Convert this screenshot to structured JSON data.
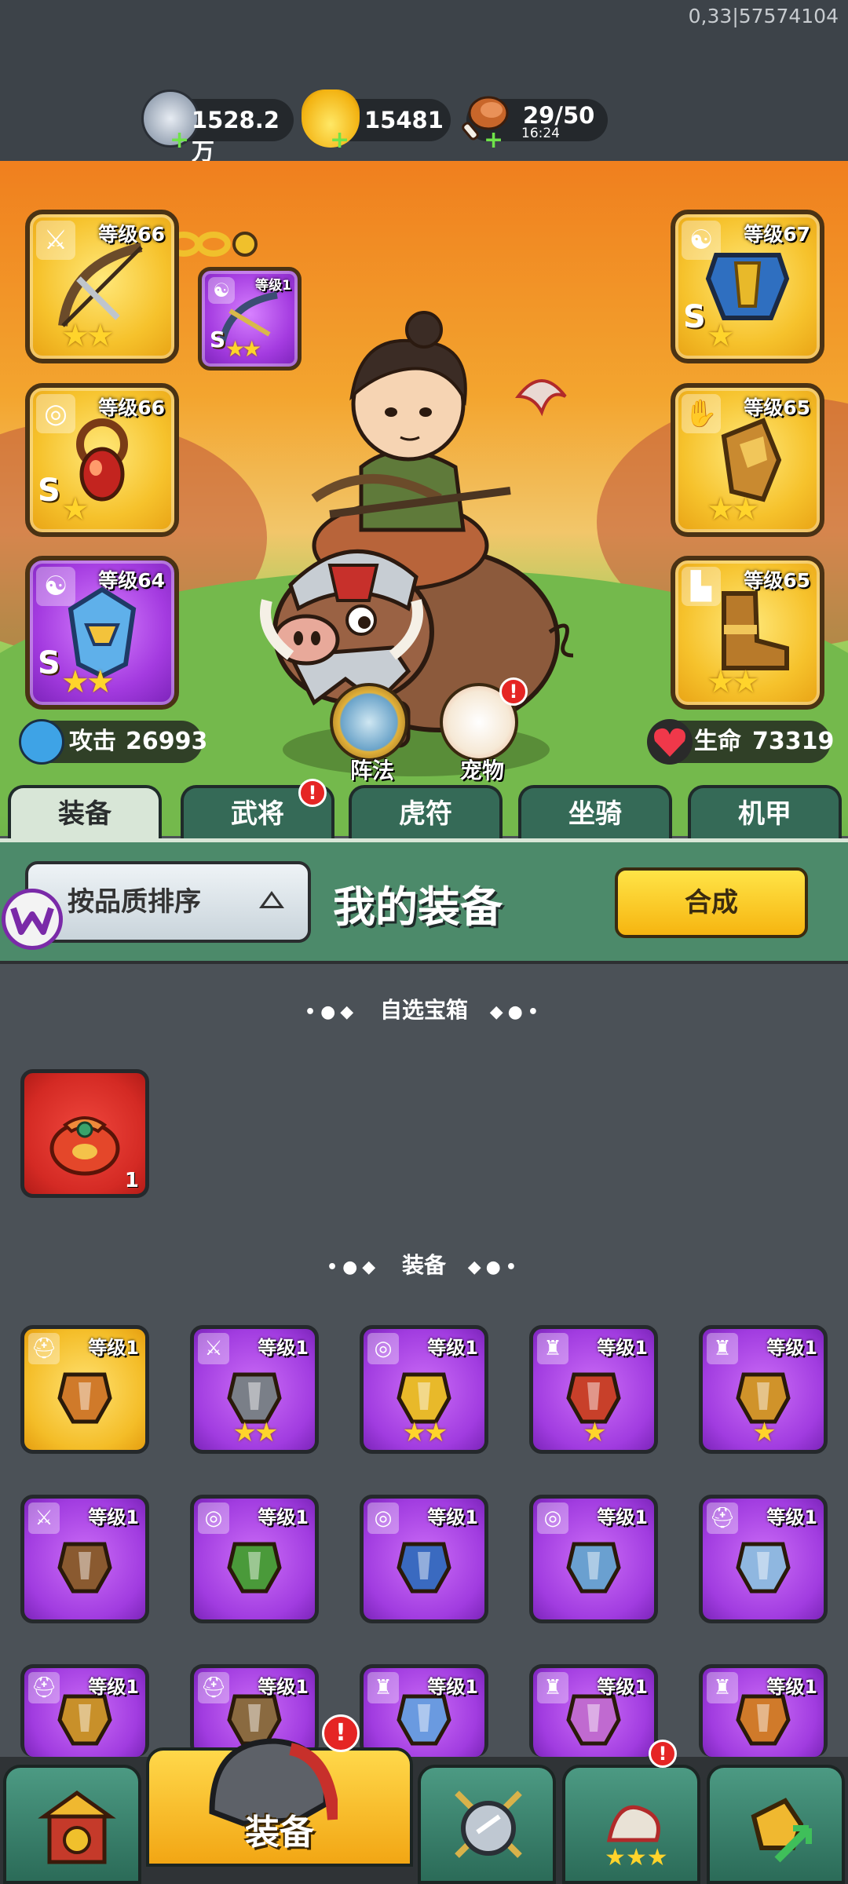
{
  "debug": {
    "id_text": "0,33|57574104"
  },
  "resources": {
    "silver": {
      "value": "1528.2万",
      "icon": "silver-coin-icon"
    },
    "gold": {
      "value": "15481",
      "icon": "gold-ingot-icon"
    },
    "stamina": {
      "value": "29/50",
      "timer": "16:24",
      "icon": "meat-drumstick-icon"
    }
  },
  "equipped": {
    "left": [
      {
        "level": "等级66",
        "grade": "",
        "stars": "★★",
        "type_icon": "sword-icon",
        "quality": "gold",
        "item": "crossbow-icon"
      },
      {
        "level": "等级66",
        "grade": "S",
        "stars": "★",
        "type_icon": "medal-icon",
        "quality": "gold",
        "item": "amulet-icon"
      },
      {
        "level": "等级64",
        "grade": "S",
        "stars": "★★",
        "type_icon": "yin-yang-icon",
        "quality": "purple",
        "item": "mask-icon"
      }
    ],
    "right": [
      {
        "level": "等级67",
        "grade": "S",
        "stars": "★",
        "type_icon": "yin-yang-icon",
        "quality": "gold",
        "item": "armor-icon"
      },
      {
        "level": "等级65",
        "grade": "",
        "stars": "★★",
        "type_icon": "glove-icon",
        "quality": "gold",
        "item": "gauntlet-icon"
      },
      {
        "level": "等级65",
        "grade": "",
        "stars": "★★",
        "type_icon": "boot-icon",
        "quality": "gold",
        "item": "boots-icon"
      }
    ],
    "linked": {
      "level": "等级1",
      "grade": "S",
      "stars": "★★",
      "type_icon": "yin-yang-icon",
      "quality": "purple"
    }
  },
  "stats": {
    "attack_label": "攻击",
    "attack": "26993",
    "hp_label": "生命",
    "hp": "73319"
  },
  "quick": {
    "formation": "阵法",
    "pet": "宠物",
    "badge": "!"
  },
  "tabs": [
    {
      "label": "装备",
      "active": true
    },
    {
      "label": "武将",
      "badge": "!"
    },
    {
      "label": "虎符"
    },
    {
      "label": "坐骑"
    },
    {
      "label": "机甲"
    }
  ],
  "panel": {
    "sort_label": "按品质排序",
    "title": "我的装备",
    "compose_label": "合成"
  },
  "sections": {
    "chest_title": "自选宝箱",
    "equip_title": "装备"
  },
  "chest": {
    "count": "1",
    "icon": "red-pouch-icon"
  },
  "items": [
    {
      "level": "等级1",
      "stars": "",
      "quality": "gold",
      "type_icon": "helmet-icon"
    },
    {
      "level": "等级1",
      "stars": "★★",
      "quality": "purple",
      "type_icon": "sword-icon"
    },
    {
      "level": "等级1",
      "stars": "★★",
      "quality": "purple",
      "type_icon": "medal-icon"
    },
    {
      "level": "等级1",
      "stars": "★",
      "quality": "purple",
      "type_icon": "armor-icon"
    },
    {
      "level": "等级1",
      "stars": "★",
      "quality": "purple",
      "type_icon": "armor-icon"
    },
    {
      "level": "等级1",
      "stars": "",
      "quality": "purple",
      "type_icon": "sword-icon"
    },
    {
      "level": "等级1",
      "stars": "",
      "quality": "purple",
      "type_icon": "medal-icon"
    },
    {
      "level": "等级1",
      "stars": "",
      "quality": "purple",
      "type_icon": "medal-icon"
    },
    {
      "level": "等级1",
      "stars": "",
      "quality": "purple",
      "type_icon": "medal-icon"
    },
    {
      "level": "等级1",
      "stars": "",
      "quality": "purple",
      "type_icon": "helmet-icon"
    },
    {
      "level": "等级1",
      "stars": "",
      "quality": "purple",
      "type_icon": "helmet-icon"
    },
    {
      "level": "等级1",
      "stars": "",
      "quality": "purple",
      "type_icon": "helmet-icon"
    },
    {
      "level": "等级1",
      "stars": "",
      "quality": "purple",
      "type_icon": "armor-icon"
    },
    {
      "level": "等级1",
      "stars": "",
      "quality": "purple",
      "type_icon": "armor-icon"
    },
    {
      "level": "等级1",
      "stars": "",
      "quality": "purple",
      "type_icon": "armor-icon"
    }
  ],
  "nav": [
    {
      "label": "",
      "icon": "castle-gate-icon"
    },
    {
      "label": "装备",
      "icon": "helmet-icon",
      "active": true,
      "badge": "!"
    },
    {
      "label": "",
      "icon": "shield-swords-icon"
    },
    {
      "label": "",
      "icon": "bird-stars-icon",
      "badge": "!"
    },
    {
      "label": "",
      "icon": "fist-arrow-icon"
    }
  ]
}
